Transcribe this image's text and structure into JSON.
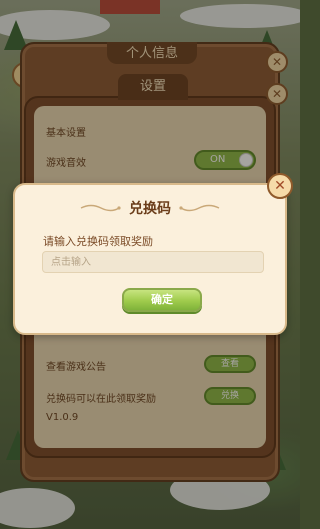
{
  "background": {
    "back_panel_title": "个人信息",
    "settings_title": "设置",
    "basic_settings": "基本设置",
    "sound_label": "游戏音效",
    "sound_state": "ON",
    "announcements_label": "查看游戏公告",
    "announcements_button": "查看",
    "redeem_row_label": "兑换码可以在此领取奖励",
    "redeem_row_button": "兑换",
    "version": "V1.0.9"
  },
  "dialog": {
    "title": "兑换码",
    "prompt": "请输入兑换码领取奖励",
    "input_placeholder": "点击输入",
    "confirm_label": "确定",
    "close_label": "✕"
  },
  "icons": {
    "help": "?",
    "close": "✕"
  },
  "colors": {
    "panel_brown": "#7b4b2c",
    "cream": "#fbf0dc",
    "button_green": "#9fcb4c"
  }
}
